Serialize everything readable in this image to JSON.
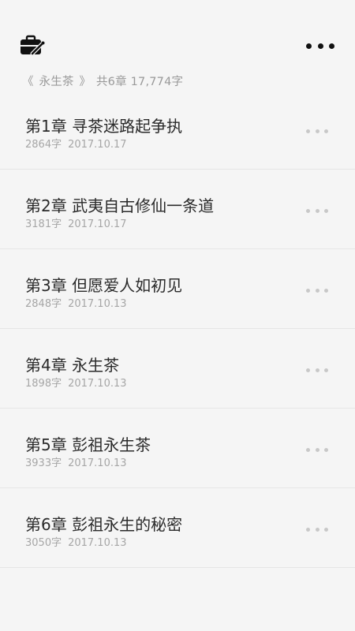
{
  "header": {
    "toolbox_icon": "toolbox-icon",
    "more_icon": "more-horizontal-icon",
    "book_open": "《",
    "book_title": "永生茶",
    "book_close": "》",
    "summary_text": "共6章 17,774字"
  },
  "chapters": [
    {
      "title": "第1章 寻茶迷路起争执",
      "words": "2864字",
      "date": "2017.10.17"
    },
    {
      "title": "第2章 武夷自古修仙一条道",
      "words": "3181字",
      "date": "2017.10.17"
    },
    {
      "title": "第3章 但愿爱人如初见",
      "words": "2848字",
      "date": "2017.10.13"
    },
    {
      "title": "第4章 永生茶",
      "words": "1898字",
      "date": "2017.10.13"
    },
    {
      "title": "第5章 彭祖永生茶",
      "words": "3933字",
      "date": "2017.10.13"
    },
    {
      "title": "第6章 彭祖永生的秘密",
      "words": "3050字",
      "date": "2017.10.13"
    }
  ],
  "colors": {
    "background": "#f5f5f5",
    "title_text": "#2a2a2a",
    "meta_text": "#a6a6a6",
    "divider": "#e6e6e6"
  }
}
